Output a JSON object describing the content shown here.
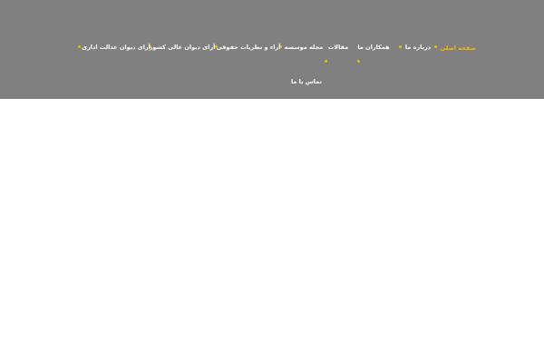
{
  "nav": {
    "items": [
      {
        "label": "صفحه اصلی",
        "active": true
      },
      {
        "label": "درباره ما",
        "active": false
      },
      {
        "label": "همکاران ما",
        "active": false
      },
      {
        "label": "مقالات",
        "active": false
      },
      {
        "label": "مجله موسسه",
        "active": false
      },
      {
        "label": "آراء و نظریات حقوقی",
        "active": false
      },
      {
        "label": "آرای دیوان عالی کشور",
        "active": false
      },
      {
        "label": "آرای دیوان عدالت اداری",
        "active": false
      },
      {
        "label": "تماس با ما",
        "active": false
      }
    ]
  },
  "colors": {
    "header_bg": "#808080",
    "accent": "#f5b800",
    "nav_text": "#ffffff"
  }
}
